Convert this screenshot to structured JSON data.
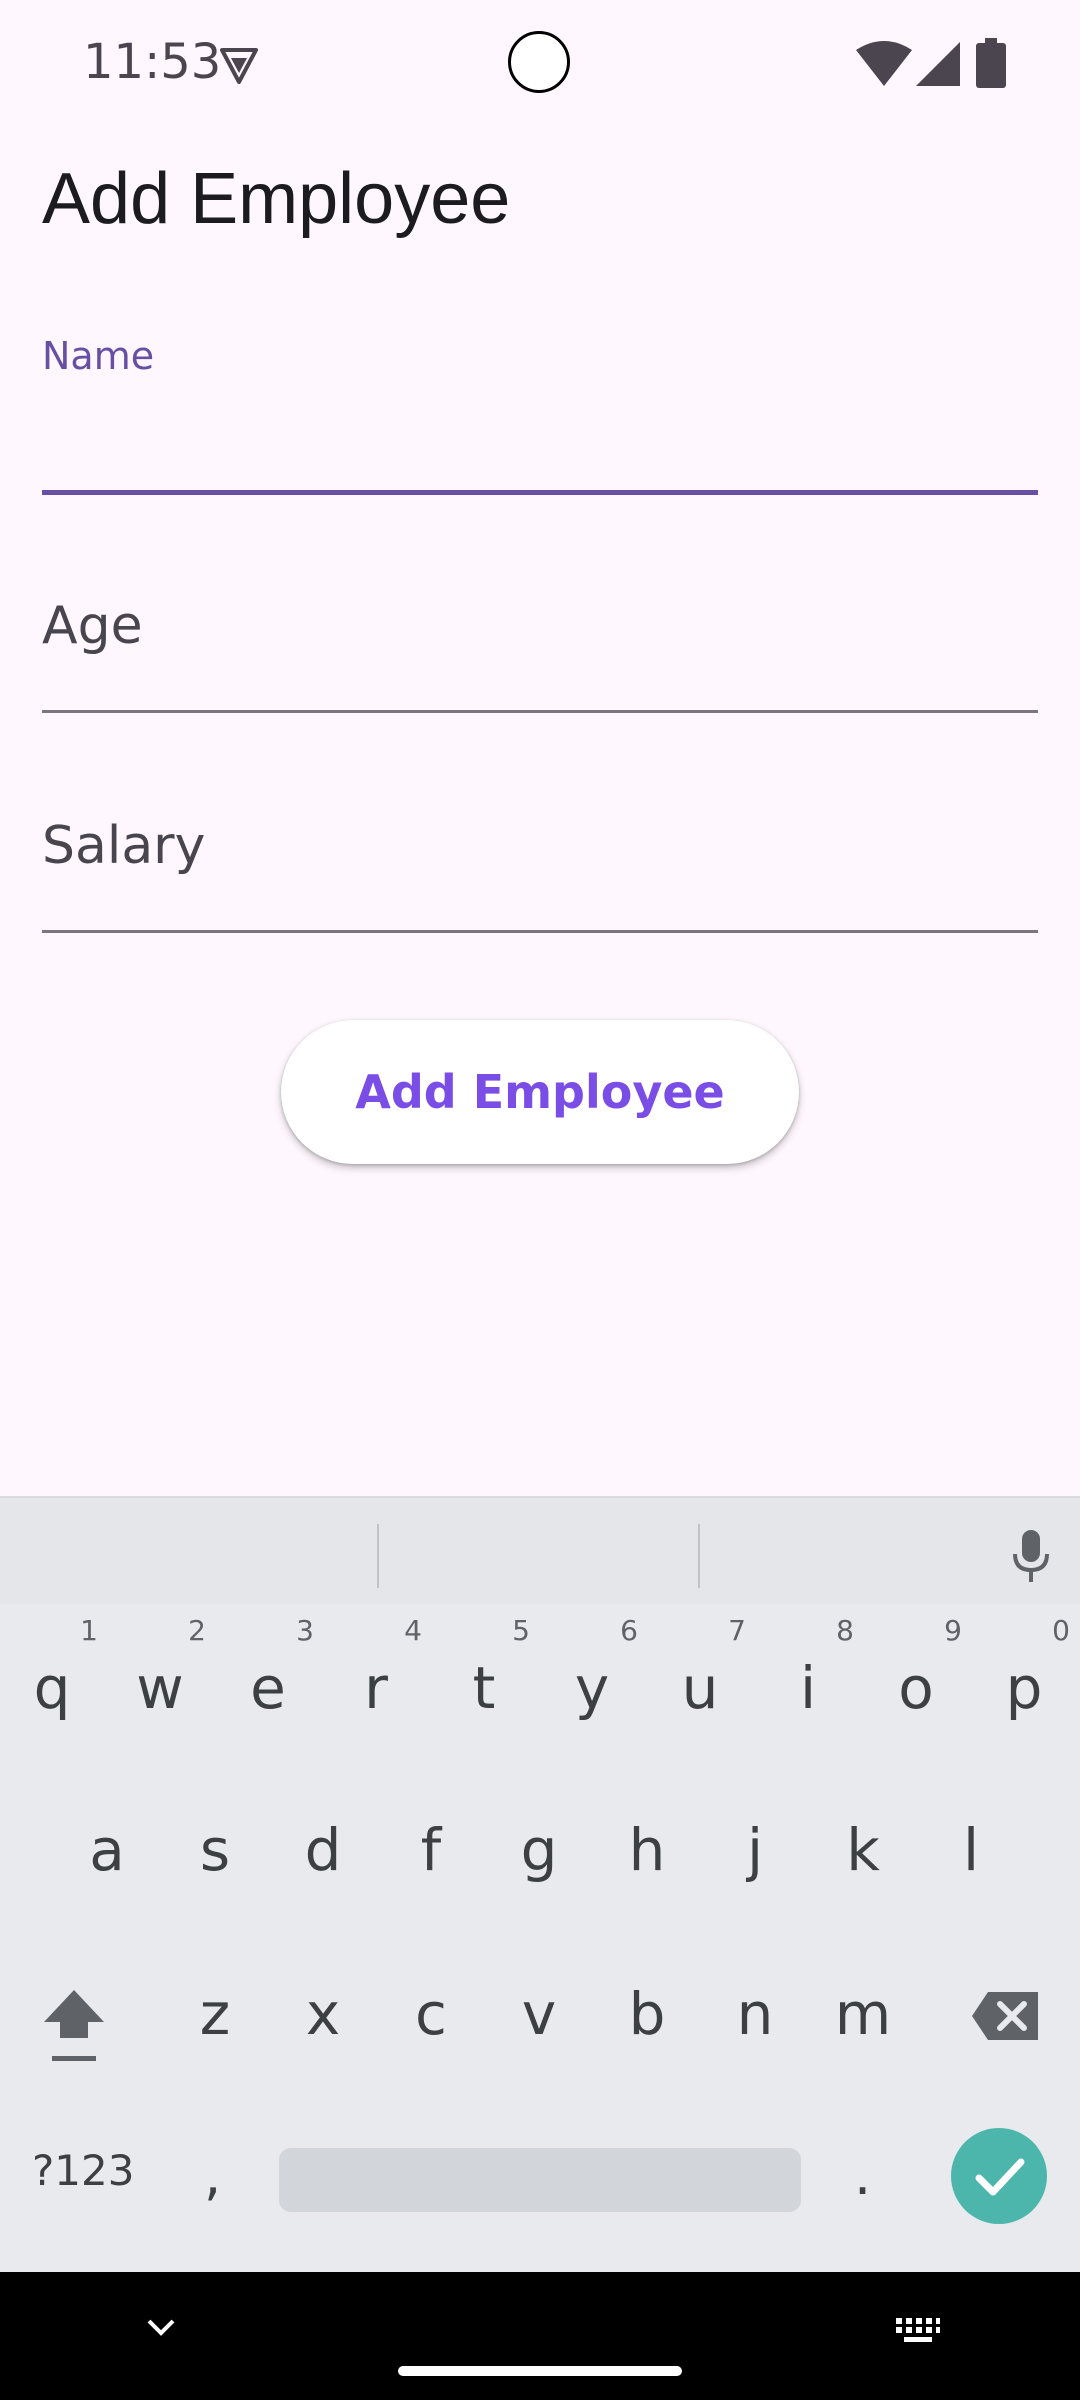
{
  "status_bar": {
    "time": "11:53"
  },
  "screen": {
    "title": "Add Employee"
  },
  "form": {
    "name_label": "Name",
    "name_value": "",
    "age_label": "Age",
    "salary_label": "Salary",
    "submit_label": "Add Employee"
  },
  "colors": {
    "accent": "#6750a4",
    "button_text": "#7a4de6",
    "enter_key": "#4db6ac",
    "background": "#fef7fd"
  },
  "keyboard": {
    "row1": [
      "q",
      "w",
      "e",
      "r",
      "t",
      "y",
      "u",
      "i",
      "o",
      "p"
    ],
    "row1_hints": [
      "1",
      "2",
      "3",
      "4",
      "5",
      "6",
      "7",
      "8",
      "9",
      "0"
    ],
    "row2": [
      "a",
      "s",
      "d",
      "f",
      "g",
      "h",
      "j",
      "k",
      "l"
    ],
    "row3": [
      "z",
      "x",
      "c",
      "v",
      "b",
      "n",
      "m"
    ],
    "symbols_key": "?123",
    "comma_key": ",",
    "period_key": "."
  },
  "icons": {
    "vpn": "vpn-key-icon",
    "wifi": "wifi-icon",
    "signal": "cell-signal-icon",
    "battery": "battery-icon",
    "mic": "microphone-icon",
    "shift": "shift-icon",
    "backspace": "backspace-icon",
    "enter": "checkmark-icon",
    "nav_back": "chevron-down-icon",
    "keyboard_switch": "keyboard-icon"
  }
}
